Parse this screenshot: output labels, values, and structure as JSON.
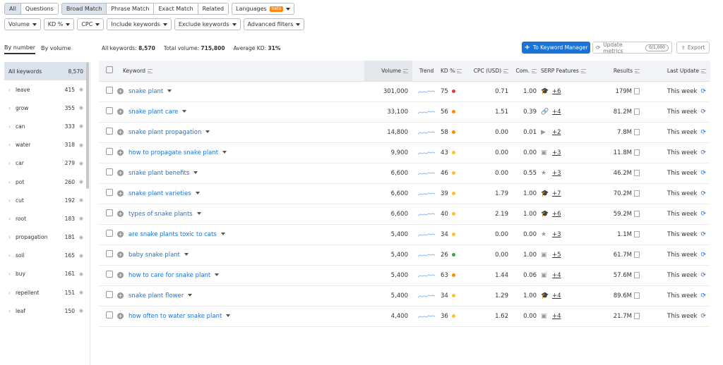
{
  "tabs_row1": {
    "all": "All",
    "questions": "Questions",
    "match": [
      "Broad Match",
      "Phrase Match",
      "Exact Match",
      "Related"
    ],
    "languages": "Languages",
    "beta": "beta"
  },
  "filters": [
    "Volume",
    "KD %",
    "CPC",
    "Include keywords",
    "Exclude keywords",
    "Advanced filters"
  ],
  "sidebar": {
    "tabs": [
      "By number",
      "By volume"
    ],
    "header": {
      "label": "All keywords",
      "count": "8,570"
    },
    "items": [
      {
        "label": "leave",
        "count": "415"
      },
      {
        "label": "grow",
        "count": "355"
      },
      {
        "label": "can",
        "count": "333"
      },
      {
        "label": "water",
        "count": "318"
      },
      {
        "label": "car",
        "count": "279"
      },
      {
        "label": "pot",
        "count": "260"
      },
      {
        "label": "cut",
        "count": "192"
      },
      {
        "label": "root",
        "count": "183"
      },
      {
        "label": "propagation",
        "count": "181"
      },
      {
        "label": "soil",
        "count": "165"
      },
      {
        "label": "buy",
        "count": "161"
      },
      {
        "label": "repellent",
        "count": "151"
      },
      {
        "label": "leaf",
        "count": "150"
      }
    ]
  },
  "summary": {
    "all_keywords_label": "All keywords:",
    "all_keywords": "8,570",
    "total_volume_label": "Total volume:",
    "total_volume": "715,800",
    "avg_kd_label": "Average KD:",
    "avg_kd": "31%"
  },
  "buttons": {
    "keyword_manager": "To Keyword Manager",
    "update_metrics": "Update metrics",
    "update_pill": "0/1,000",
    "export": "Export"
  },
  "table": {
    "headers": {
      "keyword": "Keyword",
      "volume": "Volume",
      "trend": "Trend",
      "kd": "KD %",
      "cpc": "CPC (USD)",
      "com": "Com.",
      "serp": "SERP Features",
      "results": "Results",
      "last_update": "Last Update"
    },
    "rows": [
      {
        "keyword": "snake plant",
        "volume": "301,000",
        "kd": "75",
        "kd_color": "#e53935",
        "cpc": "0.71",
        "com": "1.00",
        "serp_icon": "graduation-icon",
        "serp": "+6",
        "results": "179M",
        "update": "This week"
      },
      {
        "keyword": "snake plant care",
        "volume": "33,100",
        "kd": "56",
        "kd_color": "#fb8c00",
        "cpc": "1.51",
        "com": "0.39",
        "serp_icon": "link-icon",
        "serp": "+4",
        "results": "81.2M",
        "update": "This week"
      },
      {
        "keyword": "snake plant propagation",
        "volume": "14,800",
        "kd": "58",
        "kd_color": "#fb8c00",
        "cpc": "0.00",
        "com": "0.01",
        "serp_icon": "video-icon",
        "serp": "+2",
        "results": "7.8M",
        "update": "This week"
      },
      {
        "keyword": "how to propagate snake plant",
        "volume": "9,900",
        "kd": "43",
        "kd_color": "#fbc02d",
        "cpc": "0.00",
        "com": "0.00",
        "serp_icon": "image-icon",
        "serp": "+3",
        "results": "11.8M",
        "update": "This week"
      },
      {
        "keyword": "snake plant benefits",
        "volume": "6,600",
        "kd": "46",
        "kd_color": "#fbc02d",
        "cpc": "0.00",
        "com": "0.55",
        "serp_icon": "star-icon",
        "serp": "+3",
        "results": "46.2M",
        "update": "This week"
      },
      {
        "keyword": "snake plant varieties",
        "volume": "6,600",
        "kd": "39",
        "kd_color": "#fbc02d",
        "cpc": "1.79",
        "com": "1.00",
        "serp_icon": "graduation-icon",
        "serp": "+7",
        "results": "70.2M",
        "update": "This week"
      },
      {
        "keyword": "types of snake plants",
        "volume": "6,600",
        "kd": "40",
        "kd_color": "#fbc02d",
        "cpc": "2.19",
        "com": "1.00",
        "serp_icon": "graduation-icon",
        "serp": "+6",
        "results": "59.2M",
        "update": "This week"
      },
      {
        "keyword": "are snake plants toxic to cats",
        "volume": "5,400",
        "kd": "34",
        "kd_color": "#fbc02d",
        "cpc": "0.00",
        "com": "0.00",
        "serp_icon": "star-icon",
        "serp": "+3",
        "results": "1.1M",
        "update": "This week"
      },
      {
        "keyword": "baby snake plant",
        "volume": "5,400",
        "kd": "26",
        "kd_color": "#43a047",
        "cpc": "0.00",
        "com": "1.00",
        "serp_icon": "image-icon",
        "serp": "+5",
        "results": "61.7M",
        "update": "This week"
      },
      {
        "keyword": "how to care for snake plant",
        "volume": "5,400",
        "kd": "63",
        "kd_color": "#fb8c00",
        "cpc": "1.44",
        "com": "0.06",
        "serp_icon": "image-icon",
        "serp": "+4",
        "results": "57.6M",
        "update": "This week"
      },
      {
        "keyword": "snake plant flower",
        "volume": "5,400",
        "kd": "34",
        "kd_color": "#fbc02d",
        "cpc": "1.29",
        "com": "1.00",
        "serp_icon": "graduation-icon",
        "serp": "+4",
        "results": "89.6M",
        "update": "This week"
      },
      {
        "keyword": "how often to water snake plant",
        "volume": "4,400",
        "kd": "36",
        "kd_color": "#fbc02d",
        "cpc": "1.62",
        "com": "0.00",
        "serp_icon": "image-icon",
        "serp": "+4",
        "results": "21.7M",
        "update": "This week"
      }
    ]
  }
}
